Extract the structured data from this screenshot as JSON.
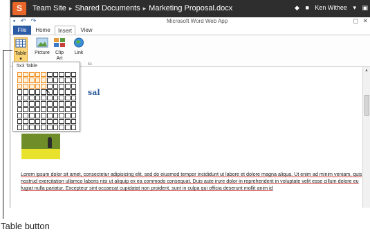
{
  "topbar": {
    "logo_letter": "S",
    "breadcrumb": [
      "Team Site",
      "Shared Documents",
      "Marketing Proposal.docx"
    ],
    "user": "Ken Withee"
  },
  "window": {
    "title": "Microsoft Word Web App"
  },
  "tabs": {
    "file": "File",
    "home": "Home",
    "insert": "Insert",
    "view": "View"
  },
  "ribbon": {
    "table": "Table",
    "picture": "Picture",
    "clip_art_line1": "Clip",
    "clip_art_line2": "Art",
    "link": "Link",
    "group_label_fragment": "ks"
  },
  "table_picker": {
    "label": "5x3 Table",
    "columns": 10,
    "rows": 10,
    "selected_columns": 5,
    "selected_rows": 3
  },
  "document": {
    "title_fragment": "sal",
    "body": "Lorem ipsum dolor sit amet, consectetur adipisicing elit, sed do eiusmod tempor incididunt ut labore et dolore magna aliqua. Ut enim ad minim veniam, quis nostrud exercitation ullamco laboris nisi ut aliquip ex ea commodo consequat. Duis aute irure dolor in reprehenderit in voluptate velit esse cillum dolore eu fugiat nulla pariatur. Excepteur sint occaecat cupidatat non proident, sunt in culpa qui officia deserunt mollit anim id"
  },
  "callout": {
    "label": "Table button"
  },
  "colors": {
    "topbar": "#2e2e2e",
    "file_tab": "#2c5ba6",
    "table_button_highlight": "#fbd575",
    "picker_selection": "#f08c1c",
    "doc_title": "#2b5a9c"
  }
}
